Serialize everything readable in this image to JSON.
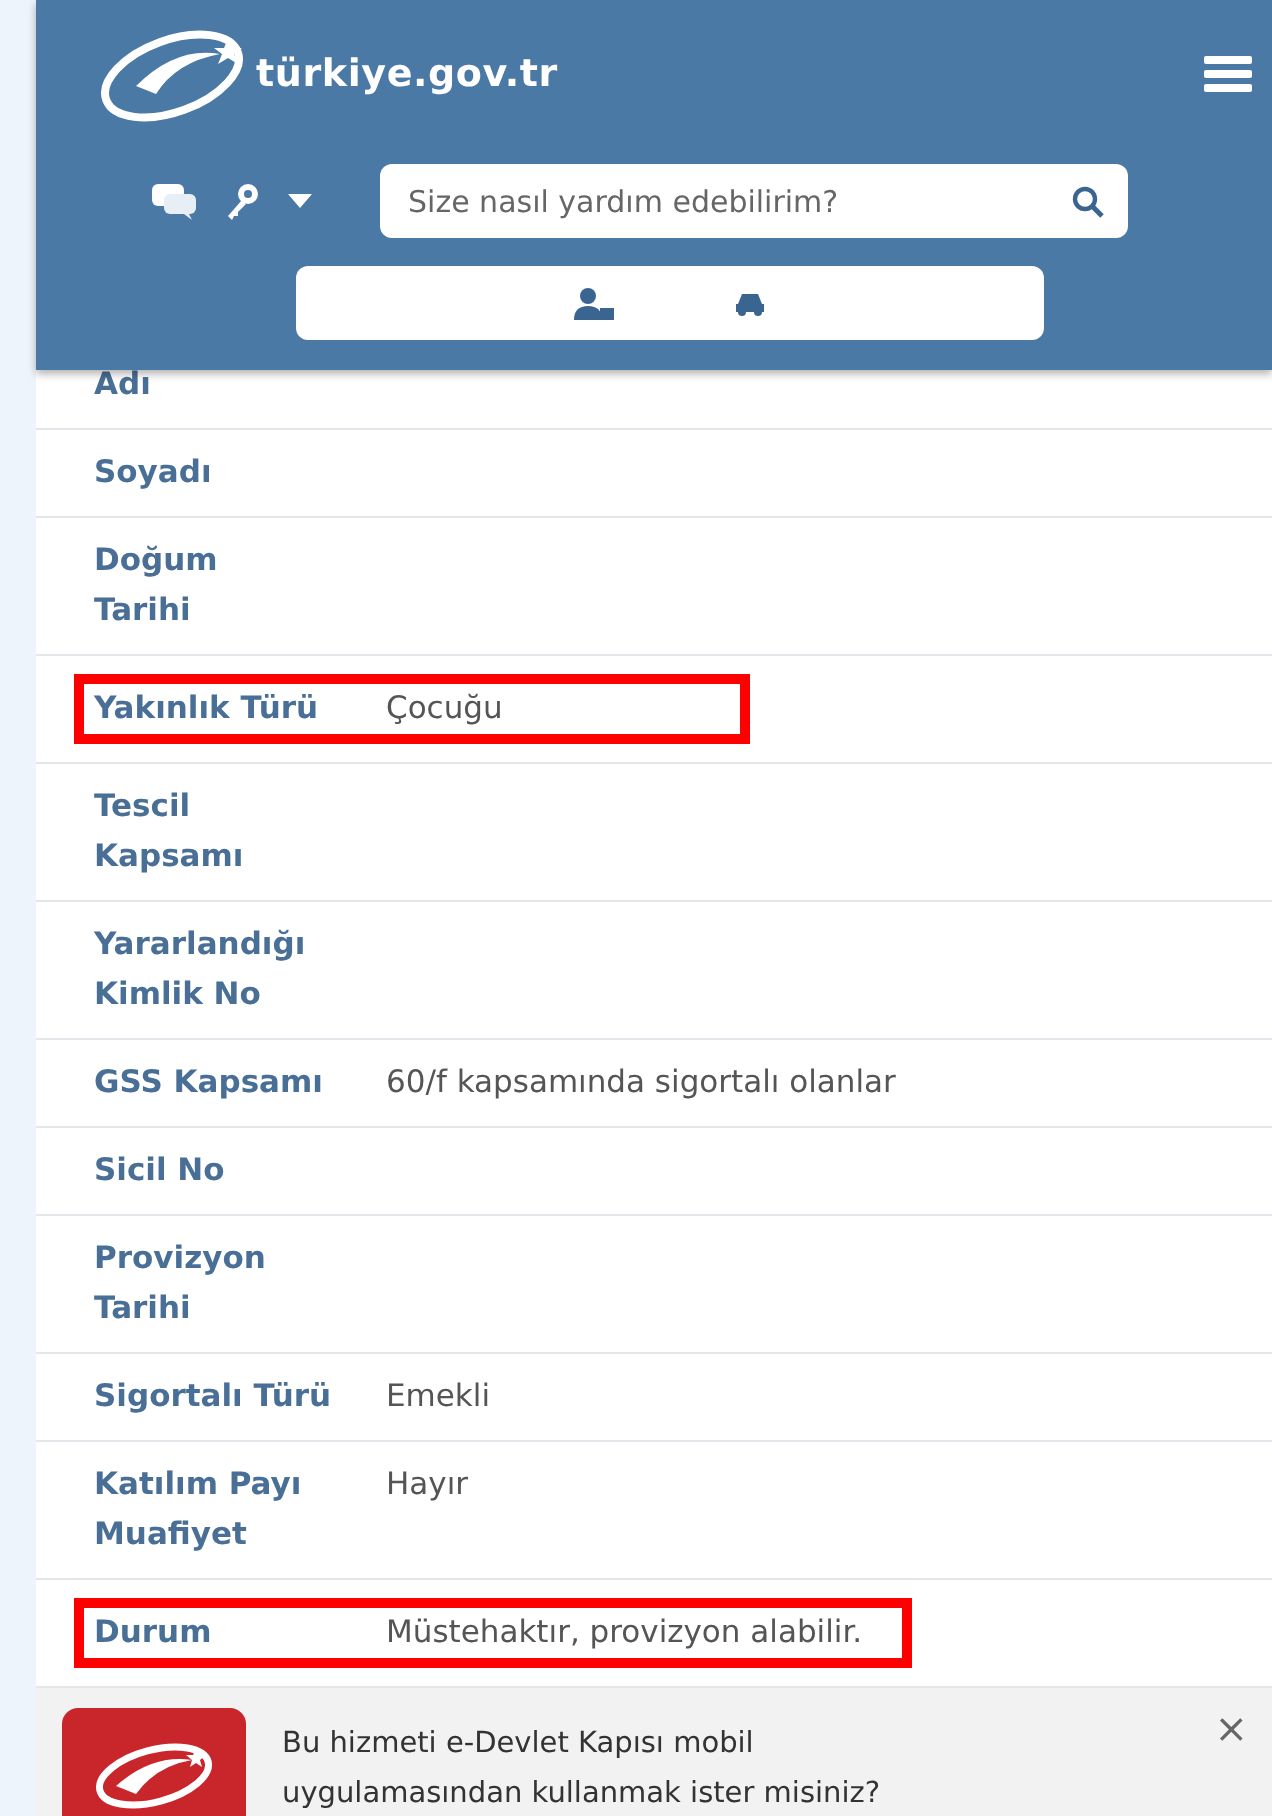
{
  "header": {
    "logo_text": "türkiye.gov.tr",
    "search": {
      "placeholder": "Size nasıl yardım edebilirim?"
    }
  },
  "rows": [
    {
      "label": "Adı",
      "highlighted": false
    },
    {
      "label": "Soyadı",
      "highlighted": false
    },
    {
      "label": "Doğum\nTarihi",
      "highlighted": false
    },
    {
      "label": "Yakınlık Türü",
      "value": "Çocuğu",
      "highlighted": true
    },
    {
      "label": "Tescil\nKapsamı",
      "highlighted": false
    },
    {
      "label": "Yararlandığı\nKimlik No",
      "highlighted": false
    },
    {
      "label": "GSS Kapsamı",
      "value": "60/f kapsamında sigortalı olanlar",
      "highlighted": false
    },
    {
      "label": "Sicil No",
      "highlighted": false
    },
    {
      "label": "Provizyon\nTarihi",
      "highlighted": false
    },
    {
      "label": "Sigortalı Türü",
      "value": "Emekli",
      "highlighted": false
    },
    {
      "label": "Katılım Payı\nMuafiyet",
      "value": "Hayır",
      "highlighted": false
    },
    {
      "label": "Durum",
      "value": "Müstehaktır, provizyon alabilir.",
      "highlighted": true
    }
  ],
  "banner": {
    "text": "Bu hizmeti e-Devlet Kapısı mobil uygulamasından kullanmak ister misiniz?",
    "close": "×"
  }
}
